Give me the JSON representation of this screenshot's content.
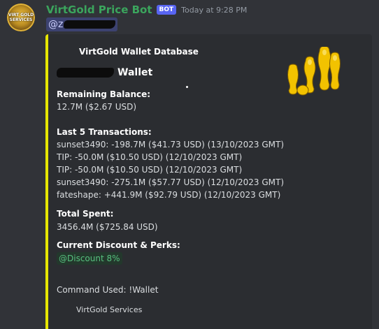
{
  "author": {
    "username": "VirtGold Price Bot",
    "bot_tag": "BOT",
    "timestamp": "Today at 9:28 PM",
    "avatar_text_line1": "VIRT GOLD",
    "avatar_text_line2": "SERVICES"
  },
  "mention": {
    "prefix": "@",
    "visible_initial": "z"
  },
  "embed": {
    "accent_color": "#e6e600",
    "author_name": "VirtGold Wallet Database",
    "title_suffix": "Wallet",
    "thumbnail_icon": "gold-coins-stack-icon",
    "fields": {
      "remaining_balance_label": "Remaining Balance:",
      "remaining_balance_value": "12.7M ($2.67 USD)",
      "last_transactions_label": "Last 5 Transactions:",
      "transactions": [
        "sunset3490: -198.7M ($41.73 USD) (13/10/2023 GMT)",
        "TIP: -50.0M ($10.50 USD) (12/10/2023 GMT)",
        "TIP: -50.0M ($10.50 USD) (12/10/2023 GMT)",
        "sunset3490: -275.1M ($57.77 USD) (12/10/2023 GMT)",
        "fateshape: +441.9M ($92.79 USD) (12/10/2023 GMT)"
      ],
      "total_spent_label": "Total Spent:",
      "total_spent_value": "3456.4M ($725.84 USD)",
      "discount_label": "Current Discount & Perks:",
      "discount_role": "@Discount 8%"
    },
    "command_used": "Command Used: !Wallet",
    "footer_text": "VirtGold Services"
  },
  "colors": {
    "background": "#313338",
    "embed_background": "#2b2d31",
    "username": "#3ba55d",
    "bot_tag": "#5865f2",
    "mention_background": "#3c4270",
    "role_text": "#57c07f"
  }
}
